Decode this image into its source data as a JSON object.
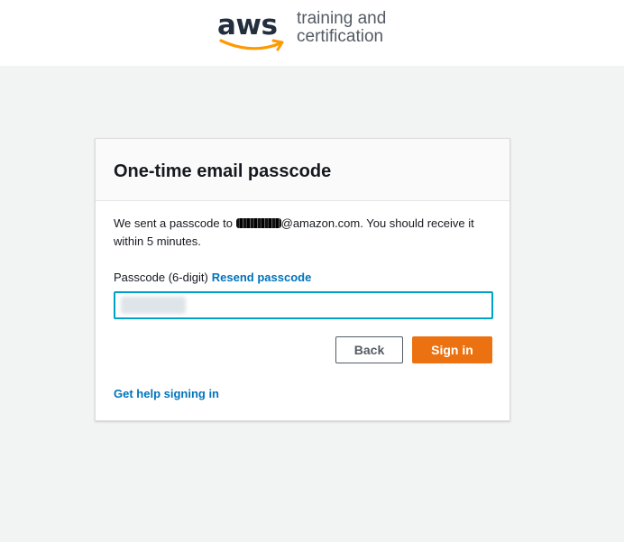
{
  "header": {
    "logo_text": "aws",
    "tagline_line1": "training and",
    "tagline_line2": "certification"
  },
  "card": {
    "title": "One-time email passcode",
    "message_prefix": "We sent a passcode to ",
    "message_suffix": "@amazon.com. You should receive it within 5 minutes.",
    "passcode_label": "Passcode (6-digit)",
    "resend_link": "Resend passcode",
    "passcode_value": "",
    "back_button": "Back",
    "signin_button": "Sign in",
    "help_link": "Get help signing in"
  },
  "colors": {
    "accent_orange": "#ec7211",
    "link_blue": "#0073bb",
    "focus_ring": "#00a1c9",
    "page_background": "#f2f3f3"
  }
}
